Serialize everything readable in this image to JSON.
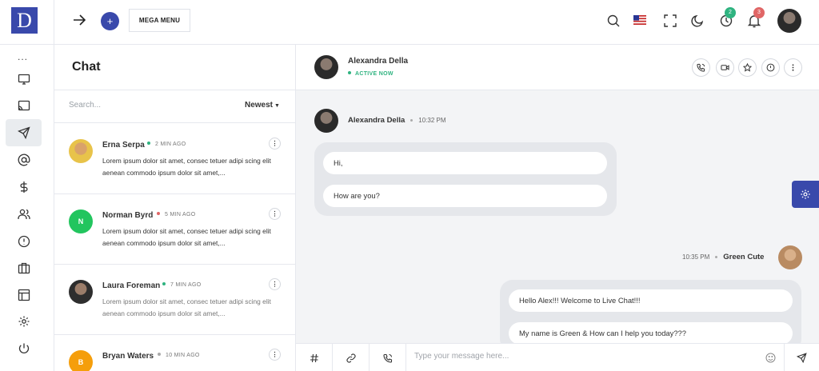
{
  "app": {
    "logo_letter": "D"
  },
  "rail": {
    "more_label": "..."
  },
  "header": {
    "mega_menu_label": "MEGA MENU",
    "plus_label": "+",
    "clock_badge": "2",
    "bell_badge": "3"
  },
  "chatlist": {
    "title": "Chat",
    "search_placeholder": "Search...",
    "sort_label": "Newest",
    "items": [
      {
        "name": "Erna Serpa",
        "time": "2 MIN AGO",
        "status_color": "#2fb380",
        "avatar_initial": "",
        "text": "Lorem ipsum dolor sit amet, consec tetuer adipi scing elit aenean commodo ipsum dolor sit amet,...",
        "unread": true
      },
      {
        "name": "Norman Byrd",
        "time": "5 MIN AGO",
        "status_color": "#e06666",
        "avatar_initial": "N",
        "text": "Lorem ipsum dolor sit amet, consec tetuer adipi scing elit aenean commodo ipsum dolor sit amet,...",
        "unread": true
      },
      {
        "name": "Laura Foreman",
        "time": "7 MIN AGO",
        "status_color": "#2fb380",
        "avatar_initial": "",
        "text": "Lorem ipsum dolor sit amet, consec tetuer adipi scing elit aenean commodo ipsum dolor sit amet,...",
        "unread": false
      },
      {
        "name": "Bryan Waters",
        "time": "10 MIN AGO",
        "status_color": "#aaaaaa",
        "avatar_initial": "B",
        "text": "",
        "unread": false
      }
    ]
  },
  "conversation": {
    "contact_name": "Alexandra Della",
    "contact_status": "ACTIVE NOW",
    "messages": [
      {
        "sender": "Alexandra Della",
        "time": "10:32 PM",
        "lines": [
          "Hi,",
          "How are you?"
        ]
      },
      {
        "sender": "Green Cute",
        "time": "10:35 PM",
        "lines": [
          "Hello Alex!!! Welcome to Live Chat!!!",
          "My name is Green & How can I help you today???"
        ]
      }
    ],
    "composer_placeholder": "Type your message here..."
  },
  "colors": {
    "accent": "#3949ab",
    "online": "#2fb380",
    "badge_green": "#2fb380",
    "badge_red": "#e06666"
  }
}
